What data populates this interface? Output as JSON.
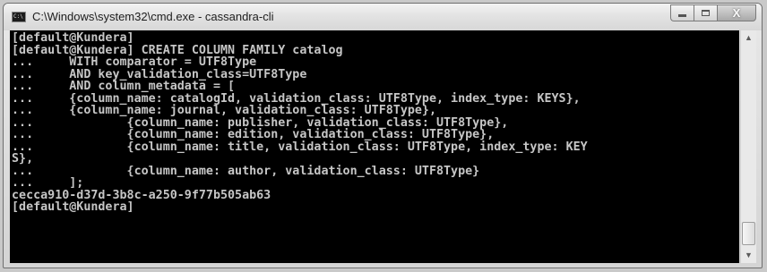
{
  "window": {
    "title": "C:\\Windows\\system32\\cmd.exe - cassandra-cli",
    "app_icon": "cmd-icon",
    "app_icon_text": "C:\\",
    "controls": {
      "minimize_icon": "minimize-icon",
      "maximize_icon": "maximize-icon",
      "close_icon": "close-icon",
      "close_glyph": "X"
    }
  },
  "console": {
    "text_color": "#c6c6c6",
    "background": "#000000",
    "lines": [
      "[default@Kundera]",
      "[default@Kundera] CREATE COLUMN FAMILY catalog",
      "...     WITH comparator = UTF8Type",
      "...     AND key_validation_class=UTF8Type",
      "...     AND column_metadata = [",
      "...     {column_name: catalogId, validation_class: UTF8Type, index_type: KEYS},",
      "...     {column_name: journal, validation_class: UTF8Type},",
      "...             {column_name: publisher, validation_class: UTF8Type},",
      "...             {column_name: edition, validation_class: UTF8Type},",
      "...             {column_name: title, validation_class: UTF8Type, index_type: KEY",
      "S},",
      "...             {column_name: author, validation_class: UTF8Type}",
      "...     ];",
      "cecca910-d37d-3b8c-a250-9f77b505ab63",
      "[default@Kundera]"
    ]
  },
  "scrollbar": {
    "up_icon": "scroll-up-arrow-icon",
    "down_icon": "scroll-down-arrow-icon",
    "up_glyph": "▲",
    "down_glyph": "▼"
  }
}
